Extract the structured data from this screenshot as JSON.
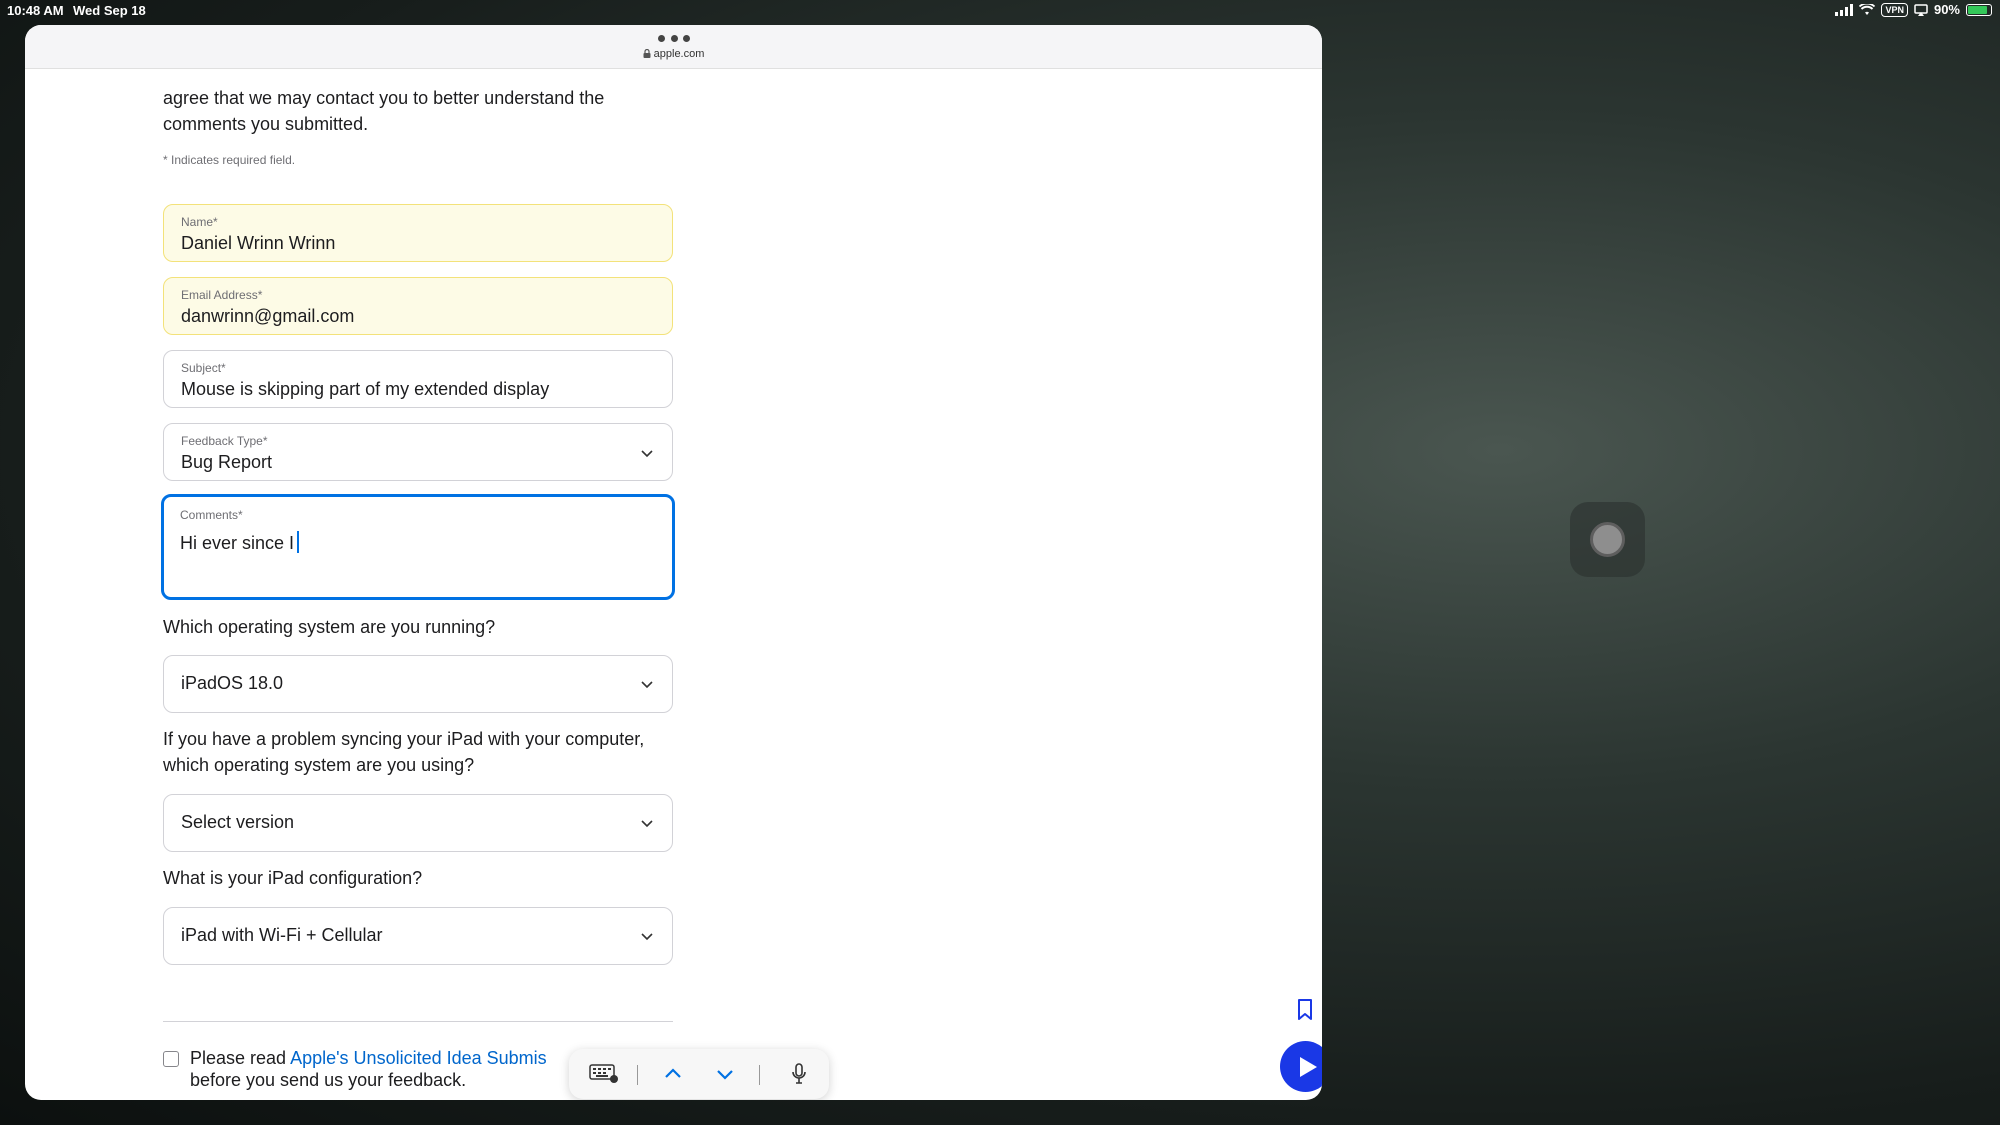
{
  "status_bar": {
    "time": "10:48 AM",
    "date": "Wed Sep 18",
    "vpn": "VPN",
    "battery": "90%",
    "battery_level": 0.9
  },
  "browser": {
    "url": "apple.com"
  },
  "form": {
    "intro": "agree that we may contact you to better understand the comments you submitted.",
    "required_note": "* Indicates required field.",
    "name": {
      "label": "Name*",
      "value": "Daniel Wrinn Wrinn"
    },
    "email": {
      "label": "Email Address*",
      "value": "danwrinn@gmail.com"
    },
    "subject": {
      "label": "Subject*",
      "value": "Mouse is skipping part of my extended display"
    },
    "feedback_type": {
      "label": "Feedback Type*",
      "value": "Bug Report"
    },
    "comments": {
      "label": "Comments*",
      "value": "Hi ever since I"
    },
    "os_question": "Which operating system are you running?",
    "os_value": "iPadOS 18.0",
    "sync_question": "If you have a problem syncing your iPad with your computer, which operating system are you using?",
    "sync_value": "Select version",
    "config_question": "What is your iPad configuration?",
    "config_value": "iPad with Wi-Fi + Cellular",
    "consent_prefix": "Please read ",
    "consent_link": "Apple's Unsolicited Idea Submis",
    "consent_suffix": "before you send us your feedback."
  },
  "colors": {
    "accent": "#0071e3",
    "autofill_bg": "#fdfbe6",
    "play_button": "#1a38e6"
  },
  "icons": {
    "keyboard": "keyboard-icon",
    "up": "chevron-up-icon",
    "down": "chevron-down-icon",
    "mic": "microphone-icon",
    "bookmark": "bookmark-icon",
    "play": "play-icon"
  }
}
